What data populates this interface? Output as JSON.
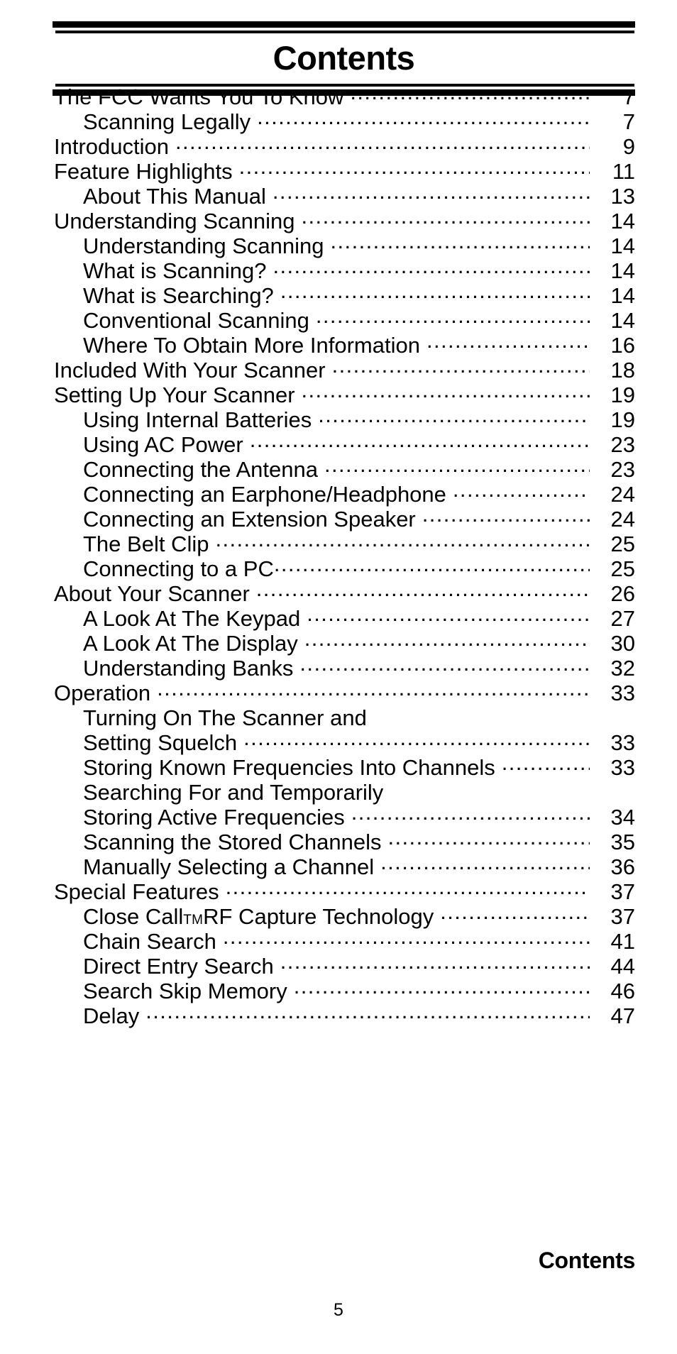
{
  "header": {
    "title": "Contents"
  },
  "toc": {
    "entries": [
      {
        "label": "The FCC Wants You To Know",
        "page": "7",
        "level": 1,
        "leader": true,
        "gap": "normal"
      },
      {
        "label": "Scanning Legally",
        "page": "7",
        "level": 2,
        "leader": true,
        "gap": "normal"
      },
      {
        "label": "Introduction",
        "page": "9",
        "level": 1,
        "leader": true,
        "gap": "normal"
      },
      {
        "label": "Feature Highlights",
        "page": "11",
        "level": 1,
        "leader": true,
        "gap": "normal"
      },
      {
        "label": "About This Manual",
        "page": "13",
        "level": 2,
        "leader": true,
        "gap": "normal"
      },
      {
        "label": "Understanding Scanning",
        "page": "14",
        "level": 1,
        "leader": true,
        "gap": "normal"
      },
      {
        "label": "Understanding Scanning",
        "page": "14",
        "level": 2,
        "leader": true,
        "gap": "normal"
      },
      {
        "label": "What is Scanning?",
        "page": "14",
        "level": 2,
        "leader": true,
        "gap": "normal"
      },
      {
        "label": "What is Searching?",
        "page": "14",
        "level": 2,
        "leader": true,
        "gap": "normal"
      },
      {
        "label": "Conventional Scanning",
        "page": "14",
        "level": 2,
        "leader": true,
        "gap": "normal"
      },
      {
        "label": "Where To Obtain More Information",
        "page": "16",
        "level": 2,
        "leader": true,
        "gap": "normal"
      },
      {
        "label": "Included With Your Scanner",
        "page": "18",
        "level": 1,
        "leader": true,
        "gap": "normal"
      },
      {
        "label": "Setting Up Your Scanner",
        "page": "19",
        "level": 1,
        "leader": true,
        "gap": "normal"
      },
      {
        "label": "Using Internal Batteries",
        "page": "19",
        "level": 2,
        "leader": true,
        "gap": "normal"
      },
      {
        "label": "Using AC Power",
        "page": "23",
        "level": 2,
        "leader": true,
        "gap": "normal"
      },
      {
        "label": "Connecting the Antenna",
        "page": "23",
        "level": 2,
        "leader": true,
        "gap": "normal"
      },
      {
        "label": "Connecting an Earphone/Headphone",
        "page": "24",
        "level": 2,
        "leader": true,
        "gap": "normal"
      },
      {
        "label": "Connecting an Extension Speaker",
        "page": "24",
        "level": 2,
        "leader": true,
        "gap": "normal"
      },
      {
        "label": "The Belt Clip",
        "page": "25",
        "level": 2,
        "leader": true,
        "gap": "normal"
      },
      {
        "label": "Connecting to a PC",
        "page": "25",
        "level": 2,
        "leader": true,
        "gap": "tight"
      },
      {
        "label": "About Your Scanner",
        "page": "26",
        "level": 1,
        "leader": true,
        "gap": "normal"
      },
      {
        "label": "A Look At The Keypad",
        "page": "27",
        "level": 2,
        "leader": true,
        "gap": "normal"
      },
      {
        "label": "A Look At The Display",
        "page": "30",
        "level": 2,
        "leader": true,
        "gap": "normal"
      },
      {
        "label": "Understanding Banks",
        "page": "32",
        "level": 2,
        "leader": true,
        "gap": "normal"
      },
      {
        "label": "Operation",
        "page": "33",
        "level": 1,
        "leader": true,
        "gap": "normal"
      },
      {
        "label": "Turning On The Scanner and",
        "page": "",
        "level": 2,
        "leader": false,
        "gap": "normal"
      },
      {
        "label": "Setting Squelch",
        "page": "33",
        "level": 2,
        "leader": true,
        "gap": "normal"
      },
      {
        "label": "Storing Known Frequencies Into Channels",
        "page": "33",
        "level": 2,
        "leader": true,
        "gap": "normal"
      },
      {
        "label": "Searching For and Temporarily",
        "page": "",
        "level": 2,
        "leader": false,
        "gap": "normal"
      },
      {
        "label": "Storing Active Frequencies",
        "page": "34",
        "level": 2,
        "leader": true,
        "gap": "normal"
      },
      {
        "label": "Scanning the Stored Channels",
        "page": "35",
        "level": 2,
        "leader": true,
        "gap": "normal"
      },
      {
        "label": "Manually Selecting a Channel",
        "page": "36",
        "level": 2,
        "leader": true,
        "gap": "normal"
      },
      {
        "label": "Special Features",
        "page": "37",
        "level": 1,
        "leader": true,
        "gap": "normal"
      },
      {
        "label": "Close Call",
        "label_suffix": " RF Capture Technology",
        "superscript": "TM",
        "page": "37",
        "level": 2,
        "leader": true,
        "gap": "normal"
      },
      {
        "label": "Chain Search",
        "page": "41",
        "level": 2,
        "leader": true,
        "gap": "normal"
      },
      {
        "label": "Direct Entry Search",
        "page": "44",
        "level": 2,
        "leader": true,
        "gap": "normal"
      },
      {
        "label": "Search Skip Memory",
        "page": "46",
        "level": 2,
        "leader": true,
        "gap": "normal"
      },
      {
        "label": "Delay",
        "page": "47",
        "level": 2,
        "leader": true,
        "gap": "normal"
      }
    ]
  },
  "footer": {
    "section_label": "Contents",
    "page_number": "5"
  }
}
